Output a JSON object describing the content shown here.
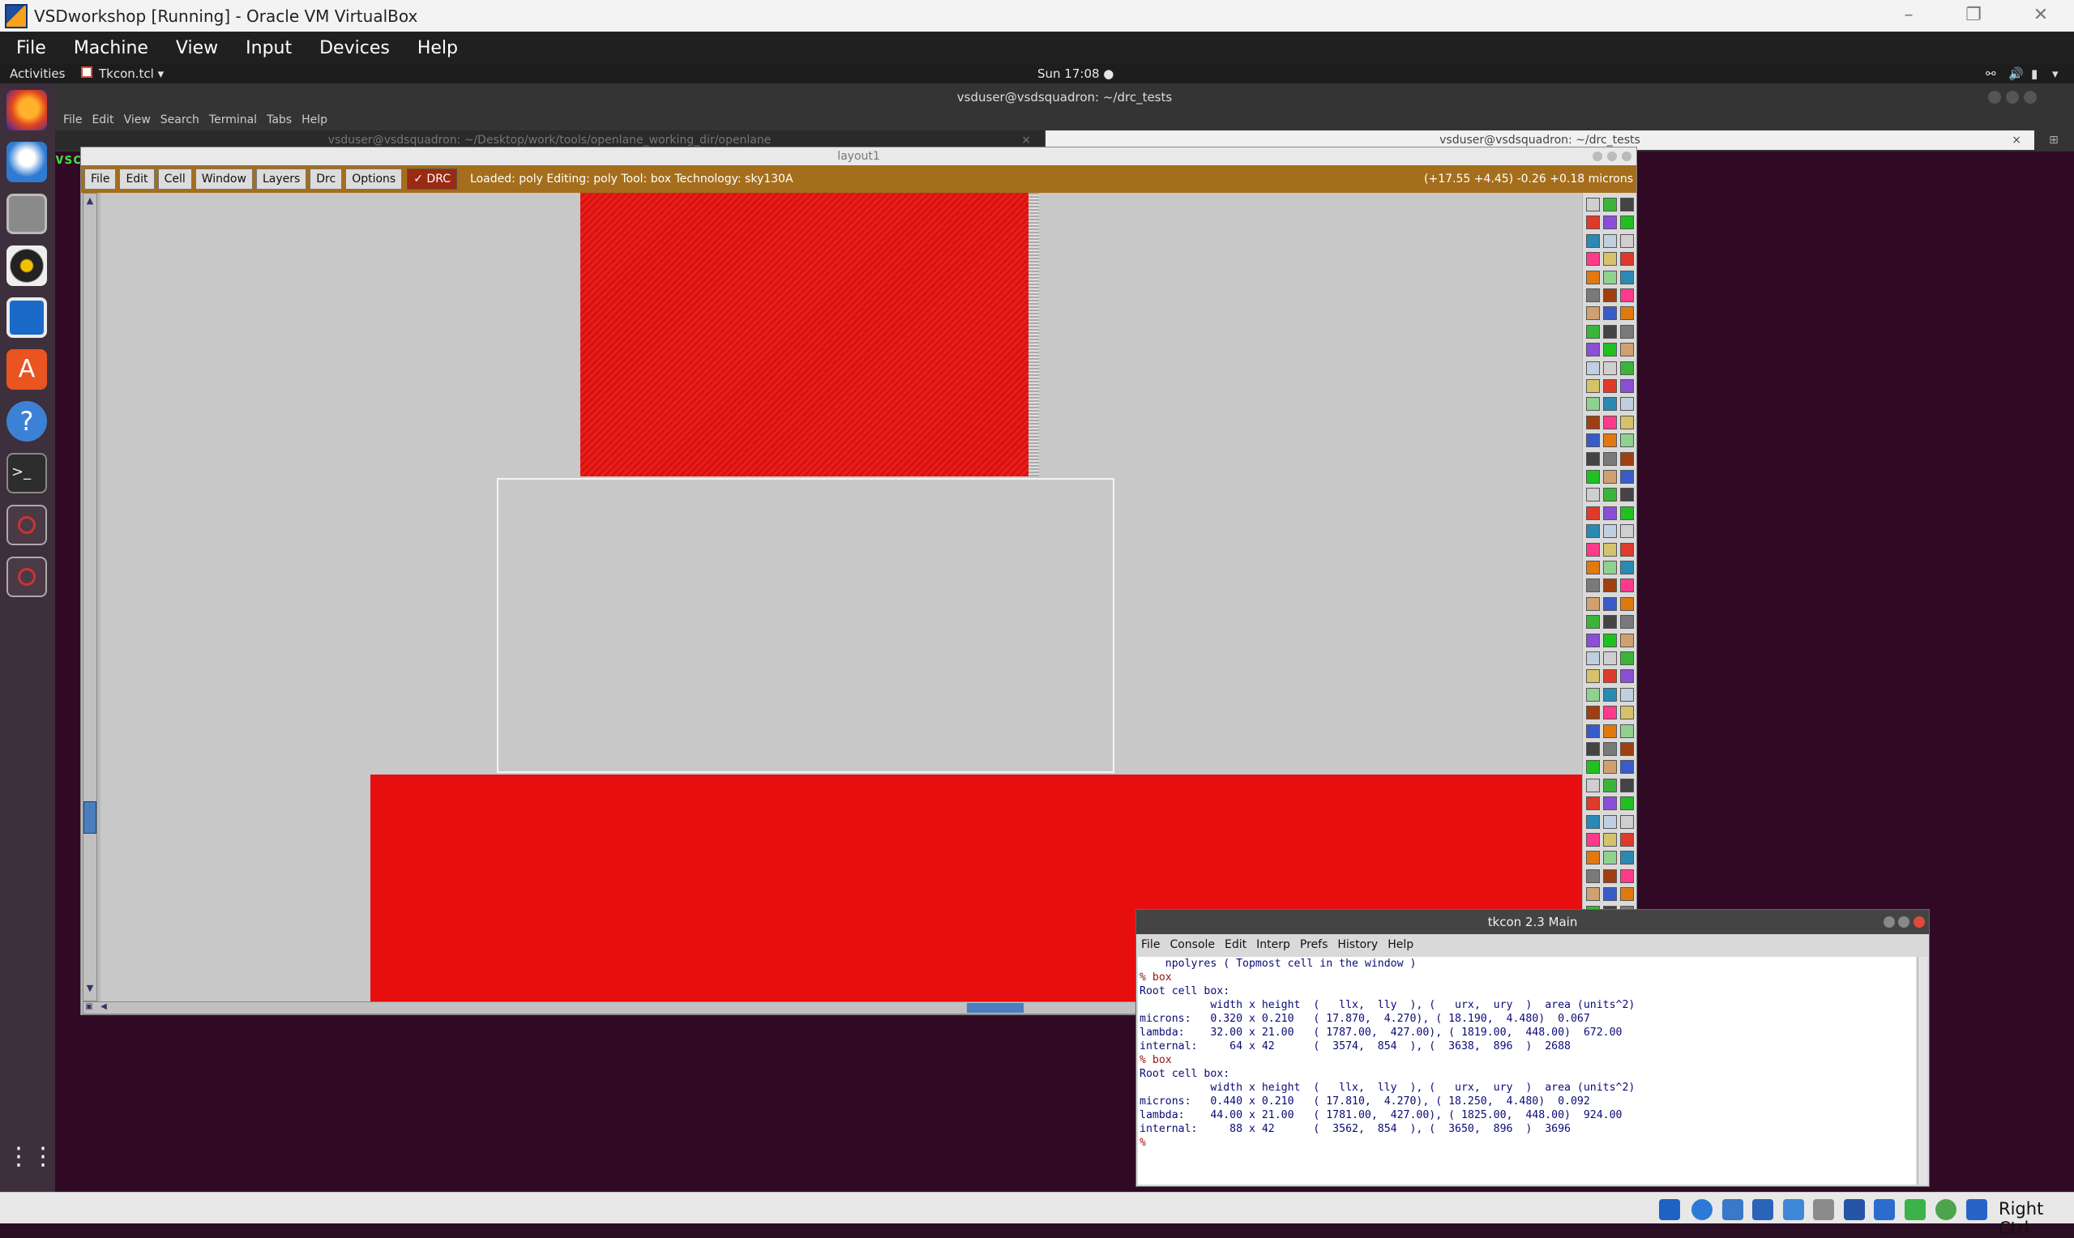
{
  "vbox": {
    "title": "VSDworkshop [Running] - Oracle VM VirtualBox",
    "menu": [
      "File",
      "Machine",
      "View",
      "Input",
      "Devices",
      "Help"
    ],
    "status_right": "Right Ctrl"
  },
  "gnome": {
    "activities": "Activities",
    "app": "Tkcon.tcl ▾",
    "clock": "Sun 17:08 ●"
  },
  "terminal": {
    "title": "vsduser@vsdsquadron: ~/drc_tests",
    "menu": [
      "File",
      "Edit",
      "View",
      "Search",
      "Terminal",
      "Tabs",
      "Help"
    ],
    "tab1": "vsduser@vsdsquadron: ~/Desktop/work/tools/openlane_working_dir/openlane",
    "tab2": "vsduser@vsdsquadron: ~/drc_tests",
    "prompt_fragment": "vsc"
  },
  "magic": {
    "title": "layout1",
    "menu": [
      "File",
      "Edit",
      "Cell",
      "Window",
      "Layers",
      "Drc",
      "Options"
    ],
    "drc": "✓ DRC",
    "status": "Loaded: poly Editing: poly Tool: box  Technology: sky130A",
    "coords": "(+17.55 +4.45) -0.26 +0.18 microns"
  },
  "tkcon": {
    "title": "tkcon 2.3 Main",
    "menu": [
      "File",
      "Console",
      "Edit",
      "Interp",
      "Prefs",
      "History",
      "Help"
    ],
    "lines": [
      "    npolyres ( Topmost cell in the window )",
      "% box",
      "Root cell box:",
      "           width x height  (   llx,  lly  ), (   urx,  ury  )  area (units^2)",
      "",
      "microns:   0.320 x 0.210   ( 17.870,  4.270), ( 18.190,  4.480)  0.067",
      "lambda:    32.00 x 21.00   ( 1787.00,  427.00), ( 1819.00,  448.00)  672.00",
      "internal:     64 x 42      (  3574,  854  ), (  3638,  896  )  2688",
      "% box",
      "Root cell box:",
      "           width x height  (   llx,  lly  ), (   urx,  ury  )  area (units^2)",
      "",
      "microns:   0.440 x 0.210   ( 17.810,  4.270), ( 18.250,  4.480)  0.092",
      "lambda:    44.00 x 21.00   ( 1781.00,  427.00), ( 1825.00,  448.00)  924.00",
      "internal:     88 x 42      (  3562,  854  ), (  3650,  896  )  3696",
      "% "
    ]
  },
  "colors": {
    "poly_red": "#e60e0e",
    "toolbar_brown": "#a56e1c",
    "canvas_gray": "#c8c8c8"
  }
}
